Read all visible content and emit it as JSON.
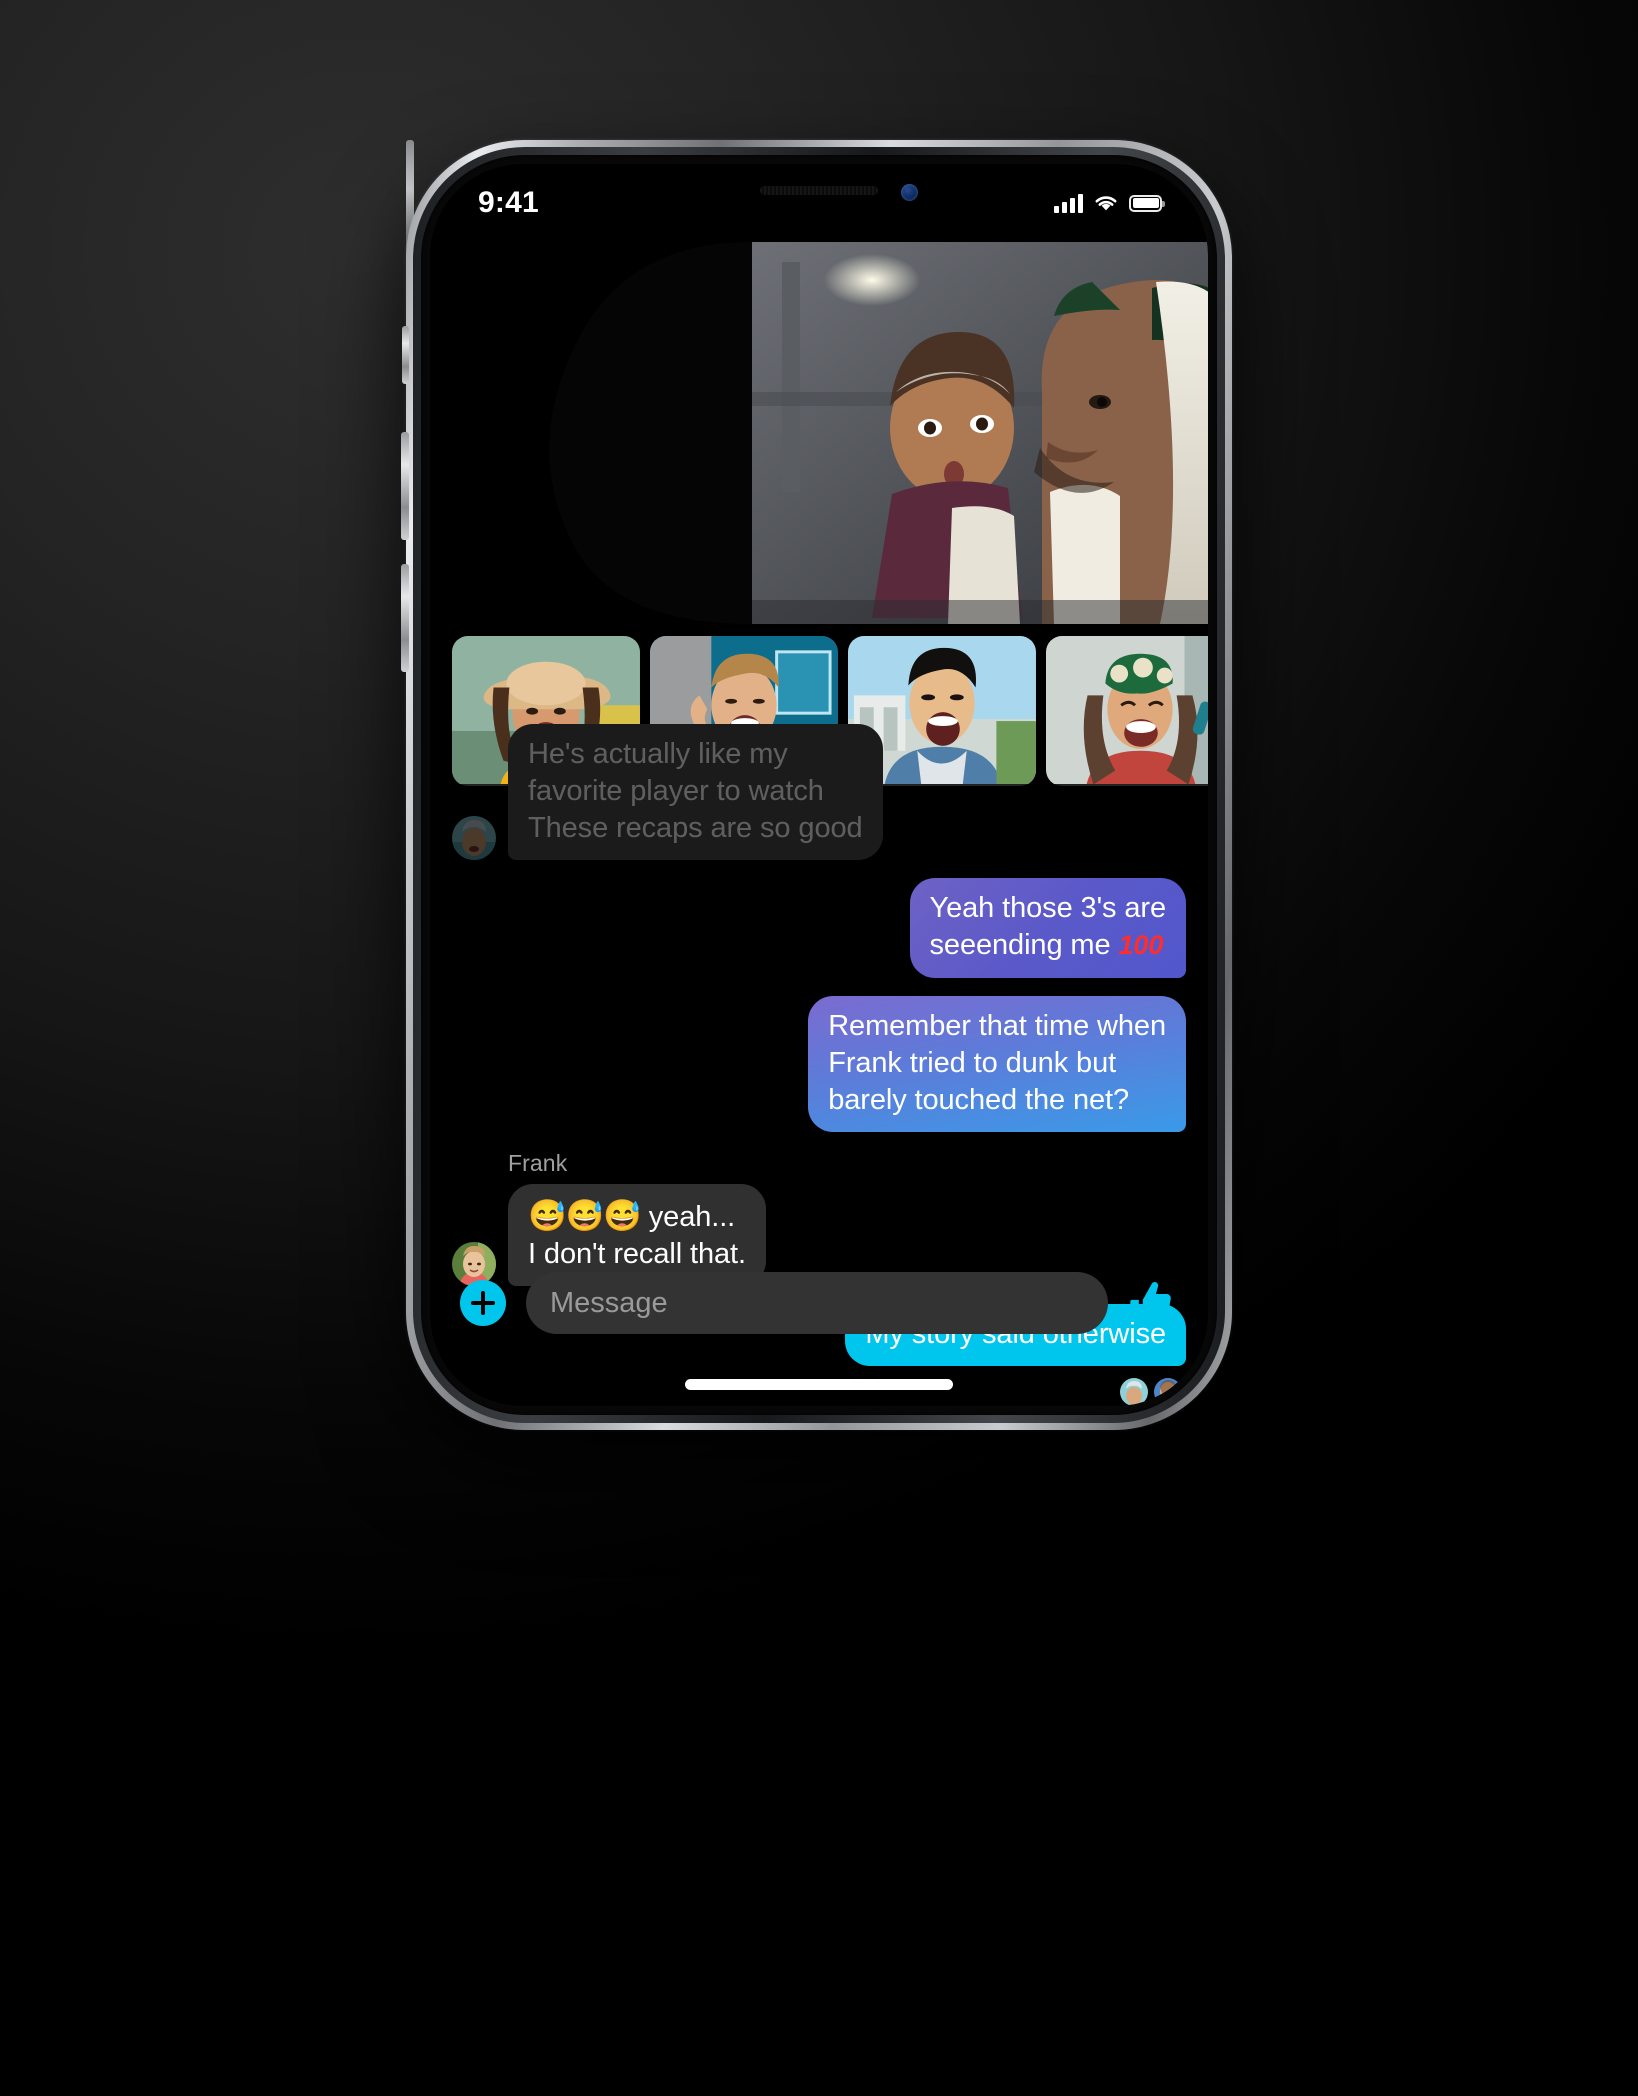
{
  "status_bar": {
    "time": "9:41",
    "signal_icon": "cellular-signal-icon",
    "wifi_icon": "wifi-icon",
    "battery_icon": "battery-icon"
  },
  "call": {
    "main_video_label": "active-speaker-video",
    "participants": [
      {
        "name": "participant-1",
        "desc": "woman in straw hat laughing"
      },
      {
        "name": "participant-2",
        "desc": "man making hand gesture"
      },
      {
        "name": "participant-3",
        "desc": "man in denim shirt cheering"
      },
      {
        "name": "participant-4",
        "desc": "woman in green headband laughing"
      }
    ]
  },
  "messages": [
    {
      "id": "m1",
      "side": "in",
      "faded": true,
      "sender": "",
      "lines": [
        "He's actually like my",
        "favorite player to watch",
        "These recaps are so good"
      ],
      "text": "He's actually like my favorite player to watch These recaps are so good"
    },
    {
      "id": "m2",
      "side": "out",
      "faded": false,
      "sender": "",
      "lines": [
        "Yeah those 3's are",
        "seeending me 💯"
      ],
      "text": "Yeah those 3's are seeending me 💯",
      "bubble_style": "grad-purple",
      "emoji": "💯"
    },
    {
      "id": "m3",
      "side": "out",
      "faded": false,
      "sender": "",
      "lines": [
        "Remember that time when",
        "Frank tried to dunk but",
        "barely touched the net?"
      ],
      "text": "Remember that time when Frank tried to dunk but barely touched the net?",
      "bubble_style": "grad-blue"
    },
    {
      "id": "m4",
      "side": "in",
      "faded": false,
      "sender": "Frank",
      "lines": [
        "😅😅😅 yeah...",
        "I don't recall that."
      ],
      "text": "😅😅😅 yeah... I don't recall that.",
      "emoji": "😅😅😅"
    },
    {
      "id": "m5",
      "side": "out",
      "faded": false,
      "sender": "",
      "lines": [
        "My story said otherwise"
      ],
      "text": "My story said otherwise",
      "bubble_style": "cyan"
    }
  ],
  "seen_by": [
    {
      "name": "seen-avatar-1"
    },
    {
      "name": "seen-avatar-2"
    }
  ],
  "composer": {
    "add_label": "+",
    "placeholder": "Message",
    "value": "",
    "like_icon": "thumbs-up-icon"
  },
  "colors": {
    "accent_cyan": "#00c6ee",
    "bubble_in": "#303030",
    "bubble_purple": "#5b59c9",
    "bubble_blue": "#3a9ae8",
    "screen_bg": "#000000",
    "page_bg": "#282828"
  }
}
